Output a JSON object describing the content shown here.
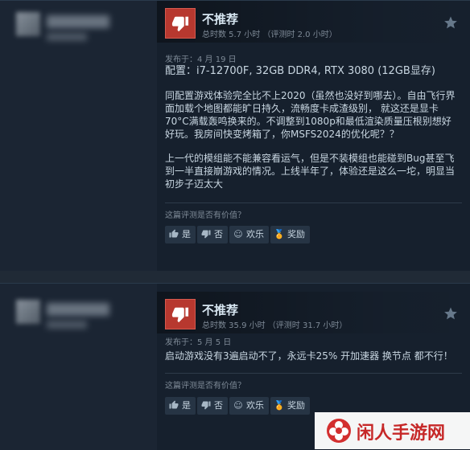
{
  "reviews": [
    {
      "verdict": "不推荐",
      "hours": "总时数 5.7 小时 （评测时 2.0 小时）",
      "posted": "发布于：4 月 19 日",
      "paragraphs": [
        "配置：i7-12700F, 32GB DDR4, RTX 3080 (12GB显存)",
        "同配置游戏体验完全比不上2020（虽然也没好到哪去）。自由飞行界面加载个地图都能旷日持久，流畅度卡成渣级别， 就这还是显卡70°C满载轰鸣换来的。不调整到1080p和最低渲染质量压根别想好好玩。我房间快变烤箱了，你MSFS2024的优化呢？？",
        "上一代的模组能不能兼容看运气，但是不装模组也能碰到Bug甚至飞到一半直接崩游戏的情况。上线半年了，体验还是这么一坨，明显当初步子迈太大"
      ],
      "helpful_question": "这篇评测是否有价值？",
      "vote": {
        "yes": "是",
        "no": "否",
        "funny": "欢乐",
        "award": "奖励"
      }
    },
    {
      "verdict": "不推荐",
      "hours": "总时数 35.9 小时 （评测时 31.7 小时）",
      "posted": "发布于：5 月 5 日",
      "paragraphs": [
        "启动游戏没有3遍启动不了，永远卡25% 开加速器 换节点 都不行！"
      ],
      "helpful_question": "这篇评测是否有价值？",
      "vote": {
        "yes": "是",
        "no": "否",
        "funny": "欢乐",
        "award": "奖励"
      }
    }
  ],
  "watermark": {
    "text": "闲人手游网"
  },
  "colors": {
    "background": "#202a36",
    "card": "#16202d",
    "not_recommended": "#b7382f",
    "watermark_red": "#c62828"
  },
  "icons": {
    "verdict": "thumbs-down-icon",
    "bookmark": "star-icon",
    "vote_yes": "thumbs-up-icon",
    "vote_no": "thumbs-down-icon",
    "vote_funny": "smiley-icon",
    "vote_award": "award-icon",
    "watermark_logo": "flower-logo-icon"
  }
}
